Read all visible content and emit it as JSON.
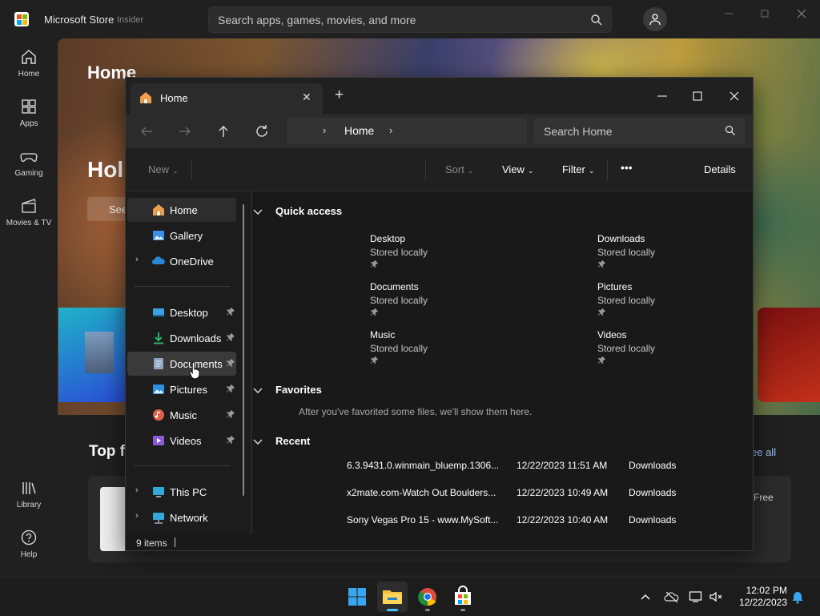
{
  "store": {
    "app_name": "Microsoft Store",
    "badge": "Insider",
    "search_placeholder": "Search apps, games, movies, and more",
    "nav": [
      {
        "label": "Home",
        "icon": "home-icon"
      },
      {
        "label": "Apps",
        "icon": "apps-icon"
      },
      {
        "label": "Gaming",
        "icon": "gaming-icon"
      },
      {
        "label": "Movies & TV",
        "icon": "movies-icon"
      },
      {
        "label": "Library",
        "icon": "library-icon"
      },
      {
        "label": "Help",
        "icon": "help-icon"
      }
    ],
    "hero_title": "Home",
    "hero_heading": "Holi",
    "hero_button": "See",
    "section_title": "Top f",
    "see_all": "ee all",
    "free_label": "Free"
  },
  "explorer": {
    "tab_title": "Home",
    "new_tab": "+",
    "address": {
      "crumb": "Home",
      "sep1": "›",
      "sep2": "›"
    },
    "search_placeholder": "Search Home",
    "toolbar": {
      "new": "New",
      "sort": "Sort",
      "view": "View",
      "filter": "Filter",
      "more": "•••",
      "details": "Details"
    },
    "sidebar": [
      {
        "label": "Home",
        "icon": "home-icon",
        "expandable": false,
        "pinned": false
      },
      {
        "label": "Gallery",
        "icon": "gallery-icon",
        "expandable": false,
        "pinned": false
      },
      {
        "label": "OneDrive",
        "icon": "onedrive-icon",
        "expandable": true,
        "pinned": false
      },
      {
        "label": "Desktop",
        "icon": "desktop-icon",
        "expandable": false,
        "pinned": true
      },
      {
        "label": "Downloads",
        "icon": "downloads-icon",
        "expandable": false,
        "pinned": true
      },
      {
        "label": "Documents",
        "icon": "documents-icon",
        "expandable": false,
        "pinned": true
      },
      {
        "label": "Pictures",
        "icon": "pictures-icon",
        "expandable": false,
        "pinned": true
      },
      {
        "label": "Music",
        "icon": "music-icon",
        "expandable": false,
        "pinned": true
      },
      {
        "label": "Videos",
        "icon": "videos-icon",
        "expandable": false,
        "pinned": true
      },
      {
        "label": "This PC",
        "icon": "this-pc-icon",
        "expandable": true,
        "pinned": false
      },
      {
        "label": "Network",
        "icon": "network-icon",
        "expandable": true,
        "pinned": false
      }
    ],
    "sections": {
      "quick_access": "Quick access",
      "favorites": "Favorites",
      "favorites_empty": "After you've favorited some files, we'll show them here.",
      "recent": "Recent"
    },
    "quick_access": [
      {
        "name": "Desktop",
        "sub": "Stored locally"
      },
      {
        "name": "Downloads",
        "sub": "Stored locally"
      },
      {
        "name": "Documents",
        "sub": "Stored locally"
      },
      {
        "name": "Pictures",
        "sub": "Stored locally"
      },
      {
        "name": "Music",
        "sub": "Stored locally"
      },
      {
        "name": "Videos",
        "sub": "Stored locally"
      }
    ],
    "recent": [
      {
        "name": "6.3.9431.0.winmain_bluemp.1306...",
        "date": "12/22/2023 11:51 AM",
        "location": "Downloads"
      },
      {
        "name": "x2mate.com-Watch Out Boulders...",
        "date": "12/22/2023 10:49 AM",
        "location": "Downloads"
      },
      {
        "name": "Sony Vegas Pro 15 - www.MySoft...",
        "date": "12/22/2023 10:40 AM",
        "location": "Downloads"
      }
    ],
    "status": "9 items"
  },
  "taskbar": {
    "time": "12:02 PM",
    "date": "12/22/2023",
    "apps": [
      "start-icon",
      "file-explorer-icon",
      "chrome-icon",
      "store-icon"
    ]
  },
  "colors": {
    "accent": "#4cc2ff",
    "window_bg": "#191919",
    "toolbar_bg": "#202020"
  }
}
